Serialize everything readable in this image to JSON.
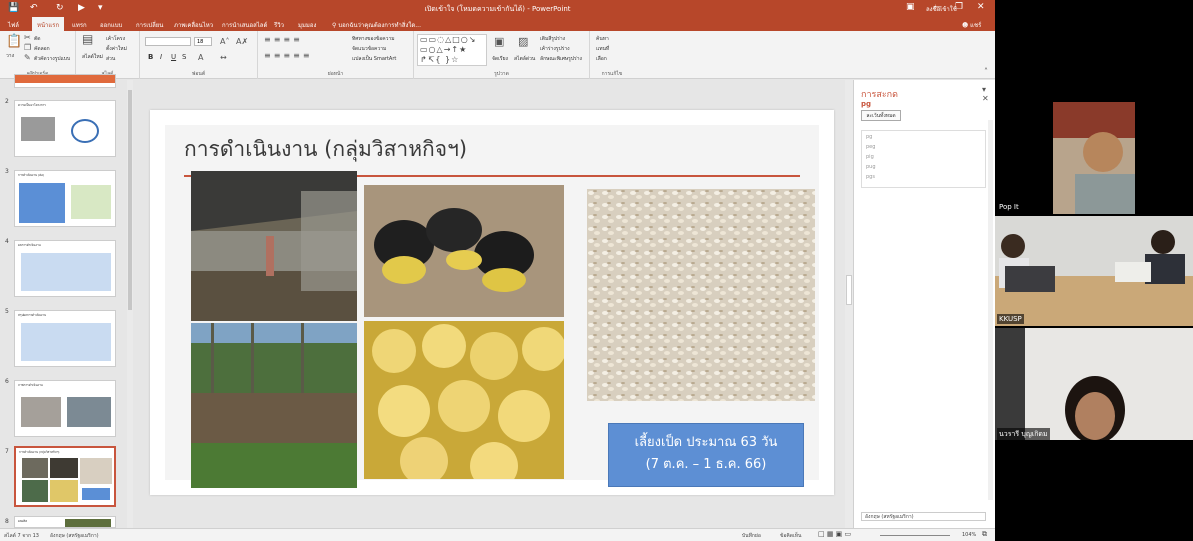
{
  "window": {
    "title": "เปิดเข้าใจ (โหมดความเข้ากันได้) - PowerPoint",
    "sign_in": "ลงชื่อเข้าใช้",
    "share": "แชร์",
    "tell_me": "บอกฉันว่าคุณต้องการทำสิ่งใด..."
  },
  "tabs": [
    "ไฟล์",
    "หน้าแรก",
    "แทรก",
    "ออกแบบ",
    "การเปลี่ยน",
    "ภาพเคลื่อนไหว",
    "การนำเสนอสไลด์",
    "รีวิว",
    "มุมมอง"
  ],
  "ribbon": {
    "clipboard": {
      "paste": "วาง",
      "cut": "ตัด",
      "copy": "คัดลอก",
      "format_painter": "ตัวคัดวางรูปแบบ",
      "label": "คลิปบอร์ด"
    },
    "slides": {
      "new_slide": "สไลด์ใหม่",
      "layout": "เค้าโครง",
      "reset": "ตั้งค่าใหม่",
      "section": "ส่วน",
      "label": "สไลด์"
    },
    "font": {
      "label": "ฟอนต์",
      "bold": "B",
      "italic": "I",
      "underline": "U",
      "strike": "S",
      "size": "18"
    },
    "paragraph": {
      "label": "ย่อหน้า",
      "text_direction": "ทิศทางของข้อความ",
      "align_text": "จัดแนวข้อความ",
      "smartart": "แปลงเป็น SmartArt"
    },
    "drawing": {
      "label": "รูปวาด",
      "arrange": "จัดเรียง",
      "quick_styles": "สไตล์ด่วน",
      "shape_fill": "เติมสีรูปร่าง",
      "shape_outline": "เค้าร่างรูปร่าง",
      "shape_effects": "ลักษณะพิเศษรูปร่าง"
    },
    "editing": {
      "label": "การแก้ไข",
      "find": "ค้นหา",
      "replace": "แทนที่",
      "select": "เลือก"
    }
  },
  "thumbnails": [
    {
      "num": "2",
      "title": "ความเป็นมาโครงการ"
    },
    {
      "num": "3",
      "title": "การดำเนินงาน (ต่อ)"
    },
    {
      "num": "4",
      "title": "ผลการดำเนินงาน"
    },
    {
      "num": "5",
      "title": "สรุปผลการดำเนินงาน"
    },
    {
      "num": "6",
      "title": "ภาพการดำเนินงาน"
    },
    {
      "num": "7",
      "title": "การดำเนินงาน (กลุ่มวิสาหกิจฯ)"
    },
    {
      "num": "8",
      "title": "ผลผลิต"
    }
  ],
  "slide": {
    "title": "การดำเนินงาน (กลุ่มวิสาหกิจฯ)",
    "caption_line1": "เลี้ยงเป็ด ประมาณ 63 วัน",
    "caption_line2": "(7 ต.ค. – 1 ธ.ค. 66)"
  },
  "spelling_pane": {
    "title": "การสะกด",
    "word": "pg",
    "ignore_all": "ละเว้นทั้งหมด",
    "suggestions": [
      "pg",
      "peg",
      "pig",
      "pug",
      "pgs"
    ],
    "language": "อังกฤษ (สหรัฐอเมริกา)"
  },
  "status": {
    "slide_info": "สไลด์ 7 จาก 13",
    "language": "อังกฤษ (สหรัฐอเมริกา)",
    "notes": "บันทึกย่อ",
    "comments": "ข้อคิดเห็น",
    "zoom": "104%"
  },
  "participants": [
    {
      "name": "Pop It"
    },
    {
      "name": "KKUSP"
    },
    {
      "name": "นวรารี บุญเกิดม"
    }
  ],
  "colors": {
    "accent": "#b7472a",
    "caption_bg": "#5d8fd4",
    "title_line": "#c8553d"
  }
}
